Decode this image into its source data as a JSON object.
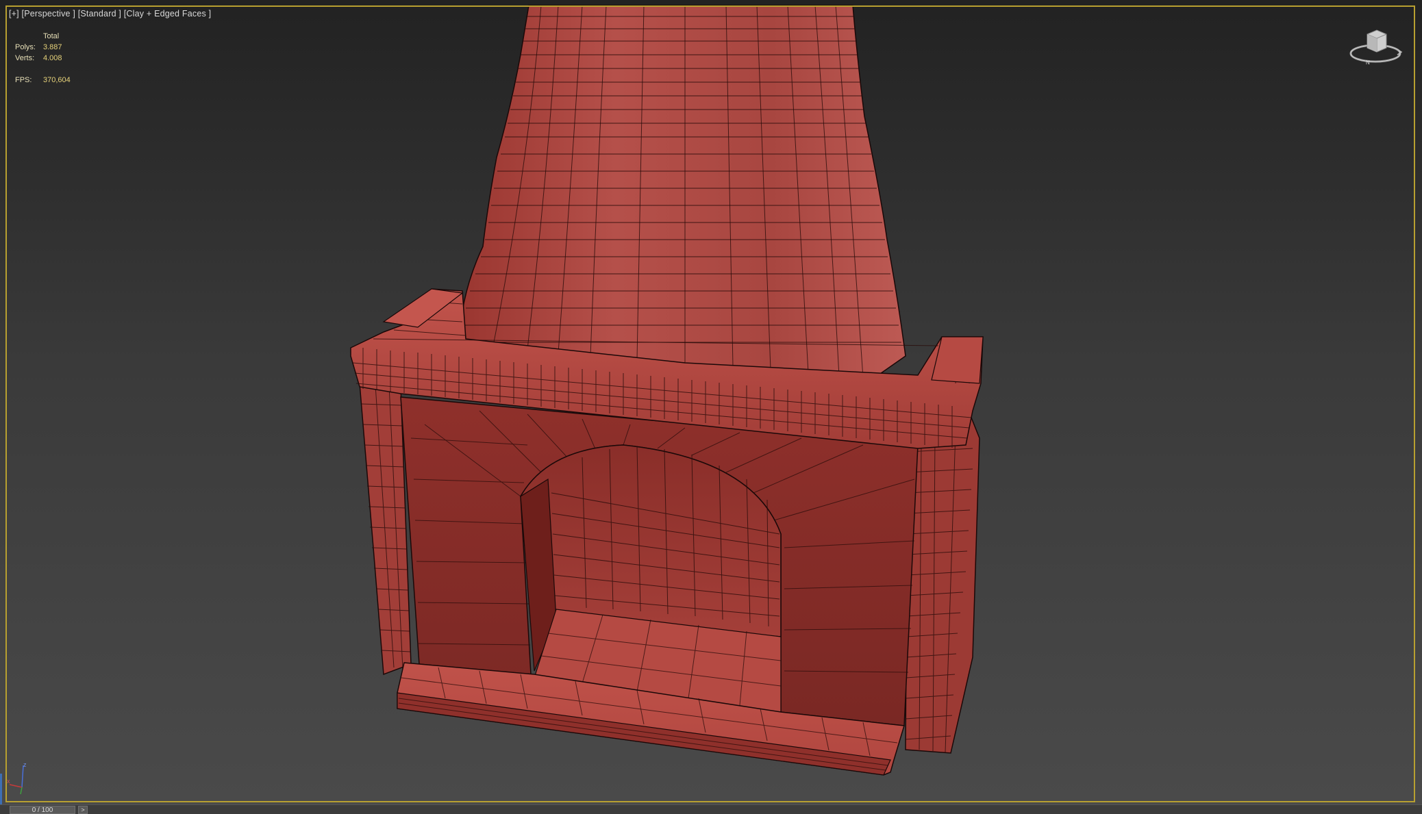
{
  "viewport": {
    "label": "[+] [Perspective ] [Standard ] [Clay + Edged Faces ]"
  },
  "stats": {
    "header": "Total",
    "polys_label": "Polys:",
    "polys_value": "3.887",
    "verts_label": "Verts:",
    "verts_value": "4.008",
    "fps_label": "FPS:",
    "fps_value": "370,604"
  },
  "viewcube": {
    "icon": "viewcube-icon",
    "compass_letter": "N"
  },
  "axis": {
    "icon": "axis-tripod-icon",
    "z_label": "z",
    "x_label": "x"
  },
  "timeline": {
    "slider_text": "0 / 100",
    "next_label": ">"
  },
  "colors": {
    "viewport_border": "#b8a030",
    "model_base": "#a83a34",
    "model_dark": "#7d2622",
    "wire": "#1a0808",
    "stats_text": "#e6d27a"
  }
}
